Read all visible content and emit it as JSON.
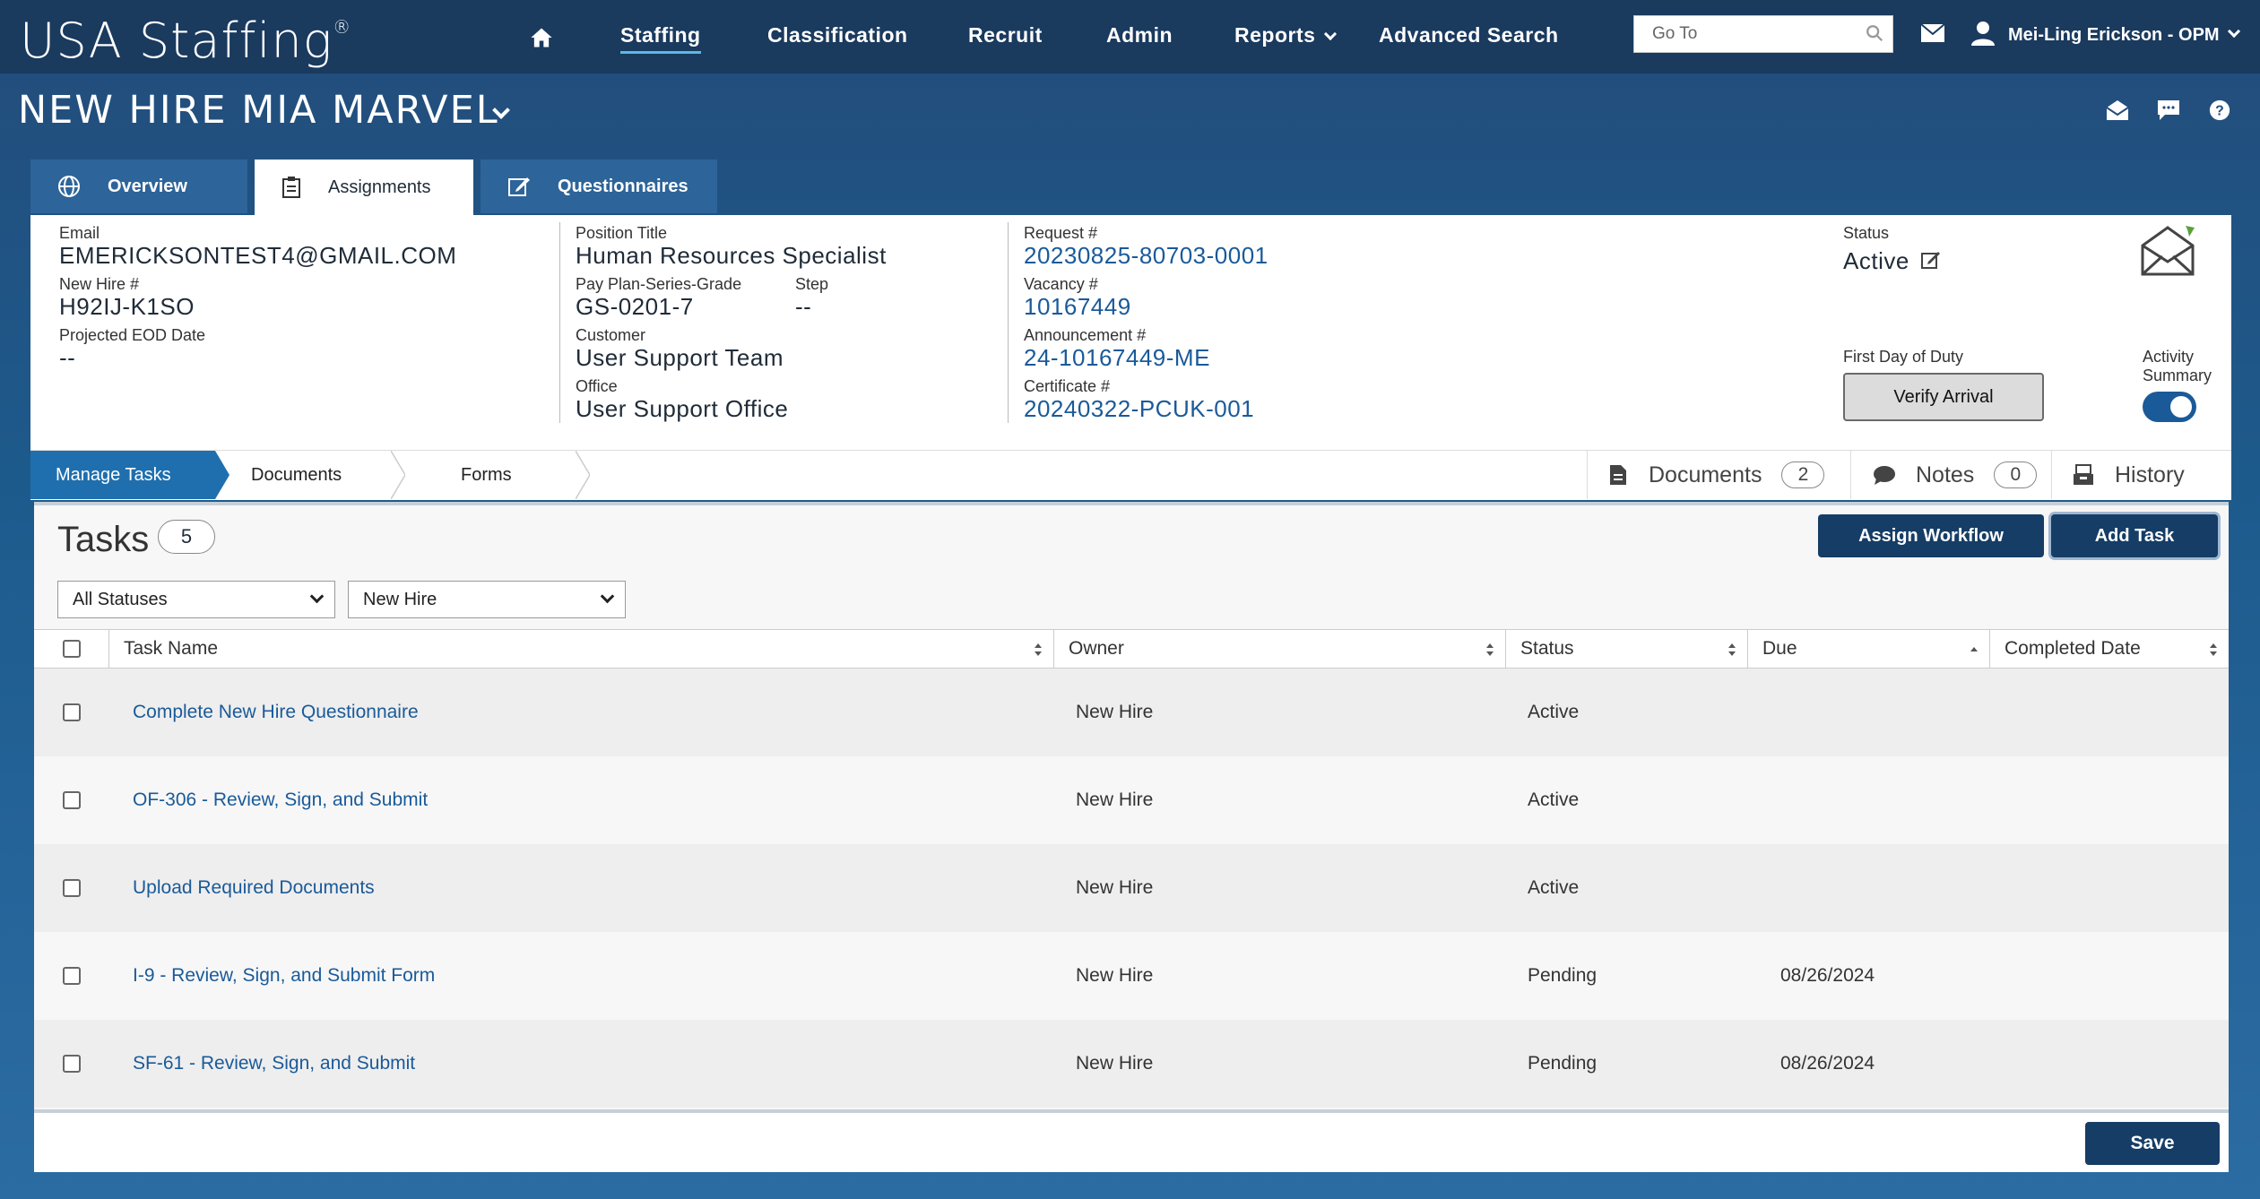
{
  "app": {
    "logo": "USA Staffing",
    "logo_mark": "®"
  },
  "nav": {
    "items": [
      {
        "label": "Staffing",
        "active": true
      },
      {
        "label": "Classification"
      },
      {
        "label": "Recruit"
      },
      {
        "label": "Admin"
      },
      {
        "label": "Reports",
        "dropdown": true
      },
      {
        "label": "Advanced Search"
      }
    ],
    "goto_placeholder": "Go To",
    "user": "Mei-Ling Erickson - OPM"
  },
  "page": {
    "title": "NEW HIRE MIA MARVEL"
  },
  "tabs": [
    {
      "label": "Overview",
      "icon": "globe-icon"
    },
    {
      "label": "Assignments",
      "icon": "clipboard-icon",
      "active": true
    },
    {
      "label": "Questionnaires",
      "icon": "edit-icon"
    }
  ],
  "info": {
    "email_label": "Email",
    "email": "EMERICKSONTEST4@GMAIL.COM",
    "newhire_label": "New Hire #",
    "newhire": "H92IJ-K1SO",
    "eod_label": "Projected EOD Date",
    "eod": "--",
    "position_label": "Position Title",
    "position": "Human Resources Specialist",
    "grade_label": "Pay Plan-Series-Grade",
    "grade": "GS-0201-7",
    "step_label": "Step",
    "step": "--",
    "customer_label": "Customer",
    "customer": "User Support Team",
    "office_label": "Office",
    "office": "User Support Office",
    "request_label": "Request #",
    "request": "20230825-80703-0001",
    "vacancy_label": "Vacancy #",
    "vacancy": "10167449",
    "announcement_label": "Announcement #",
    "announcement": "24-10167449-ME",
    "certificate_label": "Certificate #",
    "certificate": "20240322-PCUK-001",
    "status_label": "Status",
    "status": "Active",
    "fdod_label": "First Day of Duty",
    "verify_label": "Verify Arrival",
    "activity_label_1": "Activity",
    "activity_label_2": "Summary"
  },
  "subnav": {
    "crumbs": [
      "Manage Tasks",
      "Documents",
      "Forms"
    ],
    "documents_label": "Documents",
    "documents_count": "2",
    "notes_label": "Notes",
    "notes_count": "0",
    "history_label": "History"
  },
  "tasks": {
    "title": "Tasks",
    "count": "5",
    "assign_workflow": "Assign Workflow",
    "add_task": "Add Task",
    "filter_status": "All Statuses",
    "filter_owner": "New Hire",
    "columns": [
      "Task Name",
      "Owner",
      "Status",
      "Due",
      "Completed Date"
    ],
    "rows": [
      {
        "name": "Complete New Hire Questionnaire",
        "owner": "New Hire",
        "status": "Active",
        "due": "",
        "completed": ""
      },
      {
        "name": "OF-306 - Review, Sign, and Submit",
        "owner": "New Hire",
        "status": "Active",
        "due": "",
        "completed": ""
      },
      {
        "name": "Upload Required Documents",
        "owner": "New Hire",
        "status": "Active",
        "due": "",
        "completed": ""
      },
      {
        "name": "I-9 - Review, Sign, and Submit Form",
        "owner": "New Hire",
        "status": "Pending",
        "due": "08/26/2024",
        "completed": ""
      },
      {
        "name": "SF-61 - Review, Sign, and Submit",
        "owner": "New Hire",
        "status": "Pending",
        "due": "08/26/2024",
        "completed": ""
      }
    ]
  },
  "footer": {
    "save": "Save"
  }
}
